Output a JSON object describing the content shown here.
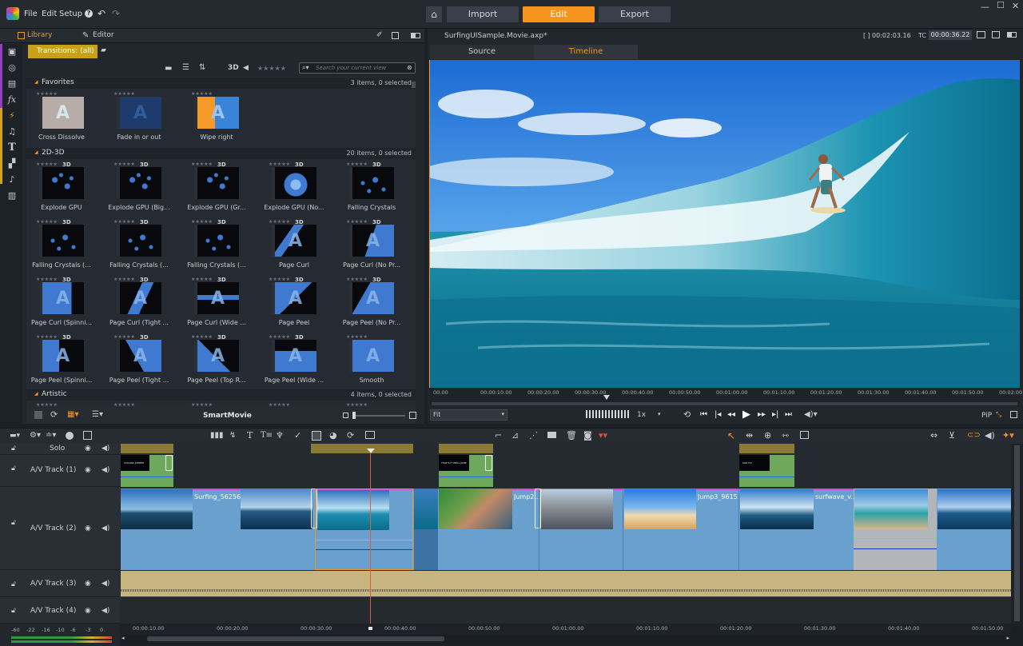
{
  "menu": {
    "file": "File",
    "edit": "Edit",
    "setup": "Setup"
  },
  "modes": {
    "import": "Import",
    "edit": "Edit",
    "export": "Export"
  },
  "library": {
    "tab_library": "Library",
    "tab_editor": "Editor",
    "filter_label": "Transitions: (all)",
    "search_placeholder": "Search your current view",
    "threeD_toggle": "3D",
    "smartmovie_label": "SmartMovie",
    "sections": [
      {
        "name": "Favorites",
        "count": "3 items, 0 selected"
      },
      {
        "name": "2D-3D",
        "count": "20 items, 0 selected"
      },
      {
        "name": "Artistic",
        "count": "4 items, 0 selected"
      }
    ],
    "favorites": [
      "Cross Dissolve",
      "Fade in or out",
      "Wipe right"
    ],
    "transitions": [
      "Explode GPU",
      "Explode GPU (Big...",
      "Explode GPU (Gr...",
      "Explode GPU (No...",
      "Falling Crystals",
      "Falling Crystals (...",
      "Falling Crystals (...",
      "Falling Crystals (...",
      "Page Curl",
      "Page Curl (No Pr...",
      "Page Curl (Spinni...",
      "Page Curl (Tight ...",
      "Page Curl (Wide ...",
      "Page Peel",
      "Page Peel (No Pr...",
      "Page Peel (Spinni...",
      "Page Peel (Tight ...",
      "Page Peel (Top R...",
      "Page Peel (Wide ...",
      "Smooth"
    ],
    "stars": "★★★★★"
  },
  "preview": {
    "title": "SurfingUISample.Movie.axp*",
    "duration": "00:02:03.16",
    "duration_prefix": "[ ]",
    "tc_label": "TC",
    "timecode": "00:00:36.22",
    "tab_source": "Source",
    "tab_timeline": "Timeline",
    "fit": "Fit",
    "speed": "1x",
    "pip": "PiP",
    "ruler": [
      "00.00",
      "00:00:10.00",
      "00:00:20.00",
      "00:00:30.00",
      "00:00:40.00",
      "00:00:50.00",
      "00:01:00.00",
      "00:01:10.00",
      "00:01:20.00",
      "00:01:30.00",
      "00:01:40.00",
      "00:01:50.00",
      "00:02:00"
    ]
  },
  "timeline": {
    "tracks": [
      {
        "name": "Solo"
      },
      {
        "name": "A/V Track (1)"
      },
      {
        "name": "A/V Track (2)"
      },
      {
        "name": "A/V Track (3)"
      },
      {
        "name": "A/V Track (4)"
      }
    ],
    "title_clips": [
      "COLLINS JUMPER",
      "THAT'S IT WELL JUMP",
      "SUR FLY"
    ],
    "clip_labels": [
      "Surfing_56256...",
      "Jump2...",
      "Jump3_9615...",
      "surfwave_v..."
    ],
    "ruler": [
      "00:00:10.00",
      "00:00:20.00",
      "00:00:30.00",
      "00:00:40.00",
      "00:00:50.00",
      "00:01:00.00",
      "00:01:10.00",
      "00:01:20.00",
      "00:01:30.00",
      "00:01:40.00",
      "00:01:50.00"
    ],
    "meter": [
      "-60",
      "-22",
      "-16",
      "-10",
      "-6",
      "-3",
      "0"
    ]
  },
  "colors": {
    "accent": "#f7941d",
    "clip_blue": "#6aa0cd",
    "audio_tan": "#c7b57f",
    "title_green": "#6ea85a"
  }
}
